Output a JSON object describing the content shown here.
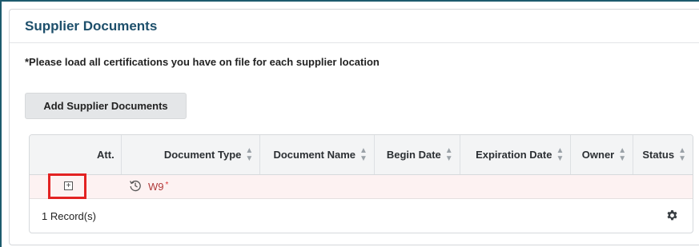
{
  "panel": {
    "title": "Supplier Documents",
    "note": "*Please load all certifications you have on file for each supplier location",
    "add_button_label": "Add Supplier Documents"
  },
  "grid": {
    "columns": [
      "Att.",
      "Document Type",
      "Document Name",
      "Begin Date",
      "Expiration Date",
      "Owner",
      "Status"
    ],
    "rows": [
      {
        "document_type": "W9",
        "required_marker": "*",
        "icons": [
          "expand-icon",
          "history-icon"
        ]
      }
    ],
    "footer": {
      "record_count": "1 Record(s)",
      "icon": "gear-icon"
    }
  },
  "colors": {
    "accent": "#1d4f6b",
    "row_highlight": "#fdf2f2",
    "annotation": "#e32222",
    "link": "#b03a3a"
  }
}
